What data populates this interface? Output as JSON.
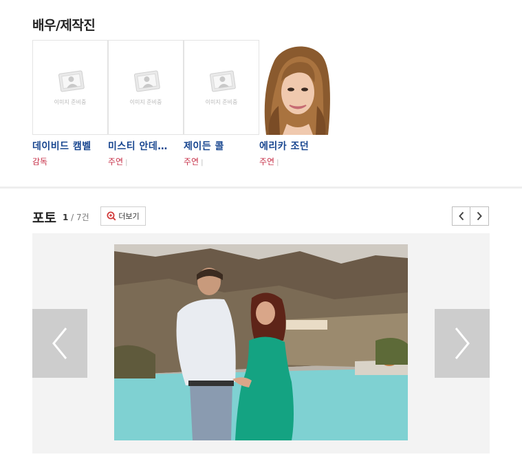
{
  "cast": {
    "title": "배우/제작진",
    "placeholder_text": "이미지 준비중",
    "members": [
      {
        "name": "데이비드 캠벨",
        "role": "감독",
        "has_photo": false
      },
      {
        "name": "미스티 안데…",
        "role": "주연",
        "has_photo": false
      },
      {
        "name": "제이든 콜",
        "role": "주연",
        "has_photo": false
      },
      {
        "name": "에리카 조던",
        "role": "주연",
        "has_photo": true
      }
    ]
  },
  "photos": {
    "title": "포토",
    "current": "1",
    "separator": " / ",
    "total": "7건",
    "more_label": "더보기"
  },
  "icons": {
    "placeholder": "user-placeholder-icon",
    "more": "magnifier-plus-icon",
    "prev": "chevron-left-icon",
    "next": "chevron-right-icon"
  },
  "colors": {
    "name": "#17458f",
    "role": "#c7324a",
    "stage_bg": "#f3f3f3",
    "arrow_bg": "#cdcdcd"
  }
}
